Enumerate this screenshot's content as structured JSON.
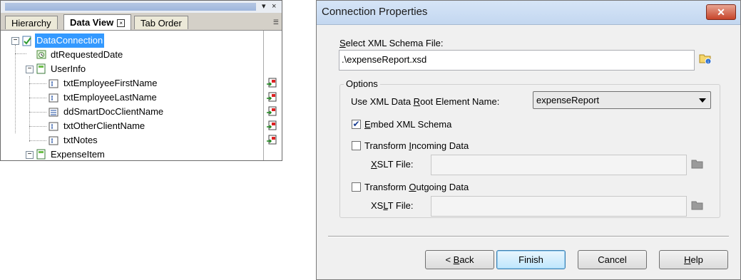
{
  "left_panel": {
    "tabs": [
      {
        "label": "Hierarchy",
        "active": false
      },
      {
        "label": "Data View",
        "active": true
      },
      {
        "label": "Tab Order",
        "active": false
      }
    ],
    "title_controls": {
      "dropdown": "▾",
      "close": "×"
    },
    "tree": [
      {
        "label": "DataConnection",
        "icon": "data-connection-icon",
        "selected": true
      },
      {
        "label": "dtRequestedDate",
        "icon": "date-field-icon"
      },
      {
        "label": "UserInfo",
        "icon": "group-node-icon"
      },
      {
        "label": "txtEmployeeFirstName",
        "icon": "text-field-icon"
      },
      {
        "label": "txtEmployeeLastName",
        "icon": "text-field-icon"
      },
      {
        "label": "ddSmartDocClientName",
        "icon": "dropdown-field-icon"
      },
      {
        "label": "txtOtherClientName",
        "icon": "text-field-icon"
      },
      {
        "label": "txtNotes",
        "icon": "text-field-icon"
      },
      {
        "label": "ExpenseItem",
        "icon": "group-node-icon"
      }
    ]
  },
  "dialog": {
    "title": "Connection Properties",
    "close_label": "✕",
    "schema_label_u": "S",
    "schema_label_rest": "elect XML Schema File:",
    "schema_value": ".\\expenseReport.xsd",
    "options_legend": "Options",
    "root_label_a": "Use XML Data ",
    "root_label_u": "R",
    "root_label_b": "oot Element Name:",
    "root_value": "expenseReport",
    "embed_u": "E",
    "embed_rest": "mbed XML Schema",
    "embed_checked": true,
    "transform_in_a": "Transform ",
    "transform_in_u": "I",
    "transform_in_b": "ncoming Data",
    "transform_in_checked": false,
    "xslt_a": "X",
    "xslt_b": "SLT File:",
    "xslt_value_1": "",
    "transform_out_a": "Transform ",
    "transform_out_u": "O",
    "transform_out_b": "utgoing Data",
    "transform_out_checked": false,
    "xslt2_a": "XS",
    "xslt2_u": "L",
    "xslt2_b": "T File:",
    "xslt_value_2": "",
    "buttons": {
      "back_a": "< ",
      "back_u": "B",
      "back_b": "ack",
      "finish": "Finish",
      "cancel": "Cancel",
      "help_u": "H",
      "help_b": "elp"
    }
  }
}
